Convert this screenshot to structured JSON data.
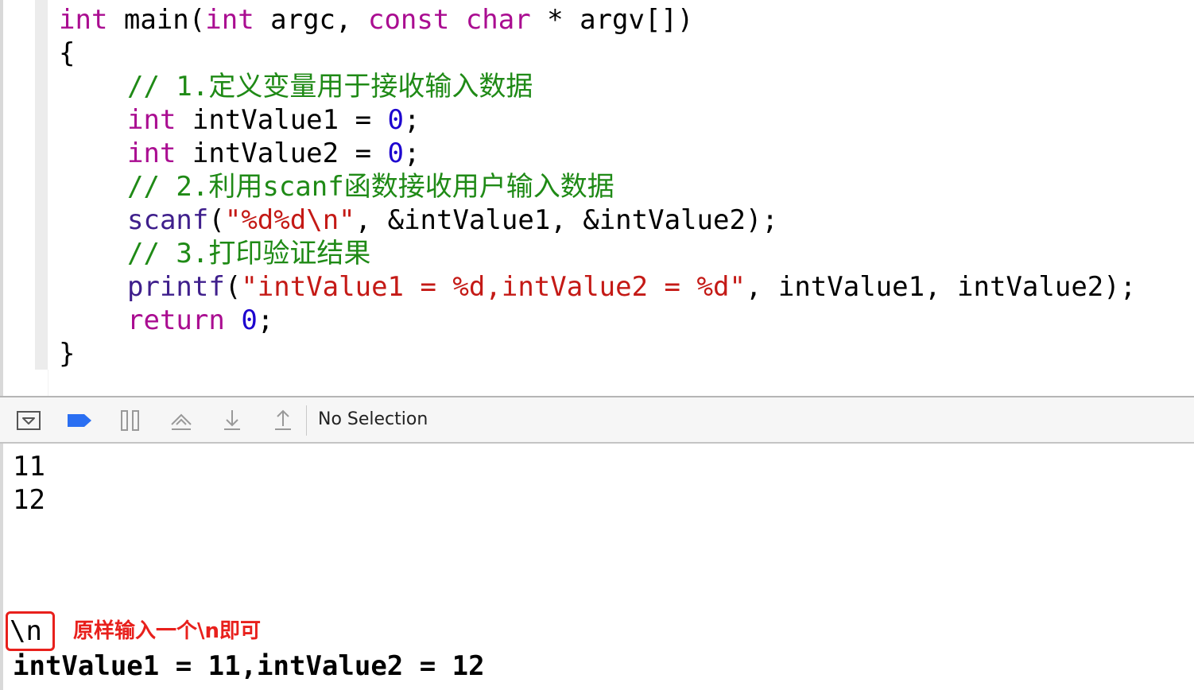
{
  "editor": {
    "line1": {
      "kw_int": "int",
      "name": " main(",
      "kw_int2": "int",
      "argc": " argc, ",
      "kw_const": "const",
      "sp": " ",
      "kw_char": "char",
      "rest": " * argv[])"
    },
    "line2": "{",
    "line3": "// 1.定义变量用于接收输入数据",
    "line4": {
      "kw": "int",
      "mid": " intValue1 = ",
      "num": "0",
      "end": ";"
    },
    "line5": {
      "kw": "int",
      "mid": " intValue2 = ",
      "num": "0",
      "end": ";"
    },
    "line6": "// 2.利用scanf函数接收用户输入数据",
    "line7": {
      "fn": "scanf",
      "open": "(",
      "str": "\"%d%d\\n\"",
      "rest": ", &intValue1, &intValue2);"
    },
    "line8": "// 3.打印验证结果",
    "line9": {
      "fn": "printf",
      "open": "(",
      "str": "\"intValue1 = %d,intValue2 = %d\"",
      "rest": ", intValue1, intValue2);"
    },
    "line10": {
      "kw": "return",
      "sp": " ",
      "num": "0",
      "end": ";"
    },
    "line11": "}"
  },
  "toolbar": {
    "status_label": "No Selection",
    "icons": [
      "hide-console-icon",
      "breakpoint-icon",
      "pause-icon",
      "step-over-icon",
      "step-into-icon",
      "step-out-icon"
    ],
    "accent_color": "#2a6ff2"
  },
  "console": {
    "input1": "11",
    "input2": "12",
    "newline_input": "\\n",
    "annotation": "原样输入一个\\n即可",
    "output": "intValue1 = 11,intValue2 = 12"
  }
}
